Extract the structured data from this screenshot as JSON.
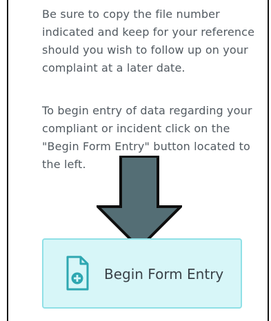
{
  "content": {
    "paragraph_1": "Be sure to copy the file number indicated and keep for your reference should you wish to follow up on your complaint at a later date.",
    "paragraph_2": "To begin entry of data regarding your compliant or incident click on the \"Begin Form Entry\" button located to the left."
  },
  "begin_button": {
    "label": "Begin Form Entry",
    "icon": "add-document-icon"
  },
  "pointer": {
    "icon": "down-arrow-icon"
  },
  "colors": {
    "text": "#525a61",
    "arrow_fill": "#546e75",
    "button_bg": "#d7f6f8",
    "button_border": "#8fe0e6",
    "icon_color": "#2ea7b1"
  }
}
